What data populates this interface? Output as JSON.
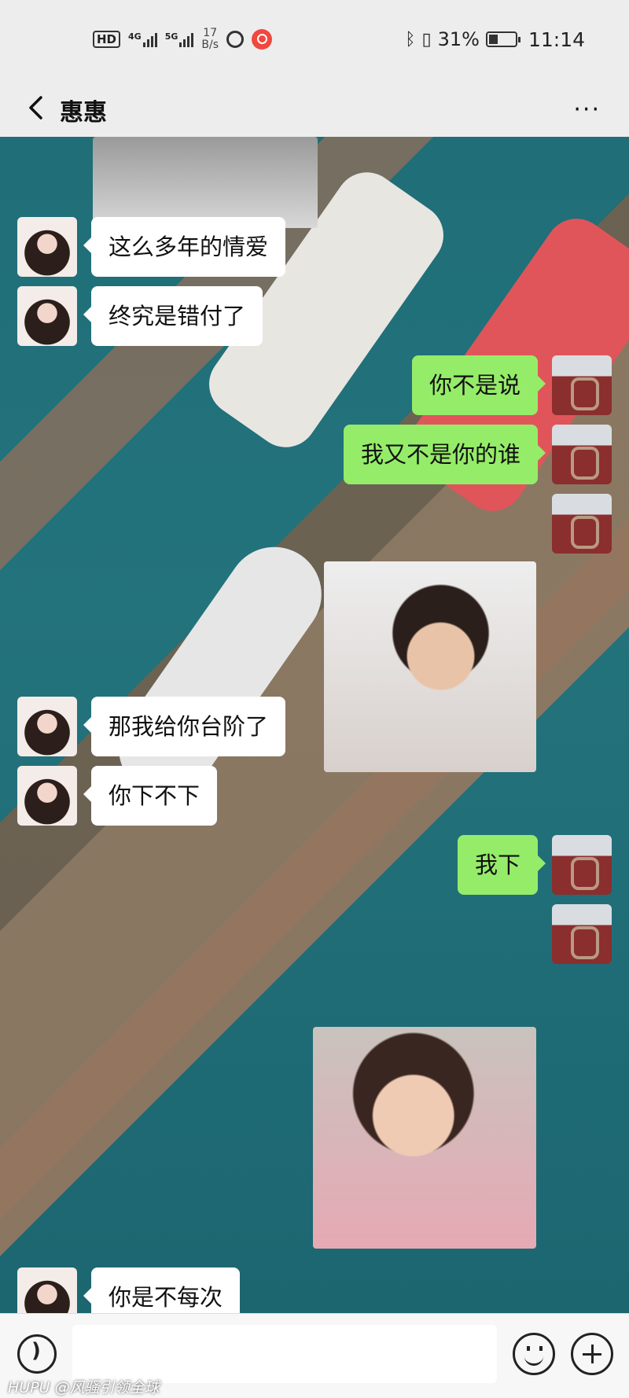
{
  "status_bar": {
    "hd": "HD",
    "net1": "4G",
    "net2": "5G",
    "speed": "17\nB/s",
    "battery_pct": "31%",
    "time": "11:14"
  },
  "header": {
    "title": "惠惠",
    "more": "···"
  },
  "messages": [
    {
      "side": "in",
      "text": "这么多年的情爱"
    },
    {
      "side": "in",
      "text": "终究是错付了"
    },
    {
      "side": "out",
      "text": "你不是说"
    },
    {
      "side": "out",
      "text": "我又不是你的谁"
    },
    {
      "side": "in",
      "text": "那我给你台阶了"
    },
    {
      "side": "in",
      "text": "你下不下"
    },
    {
      "side": "out",
      "text": "我下"
    },
    {
      "side": "in",
      "text": "你是不每次"
    }
  ],
  "input_bar": {
    "placeholder": ""
  },
  "watermark": "HUPU @风骚引领全球",
  "colors": {
    "outgoing_bubble": "#95ec69",
    "incoming_bubble": "#ffffff",
    "background": "#ededed"
  }
}
